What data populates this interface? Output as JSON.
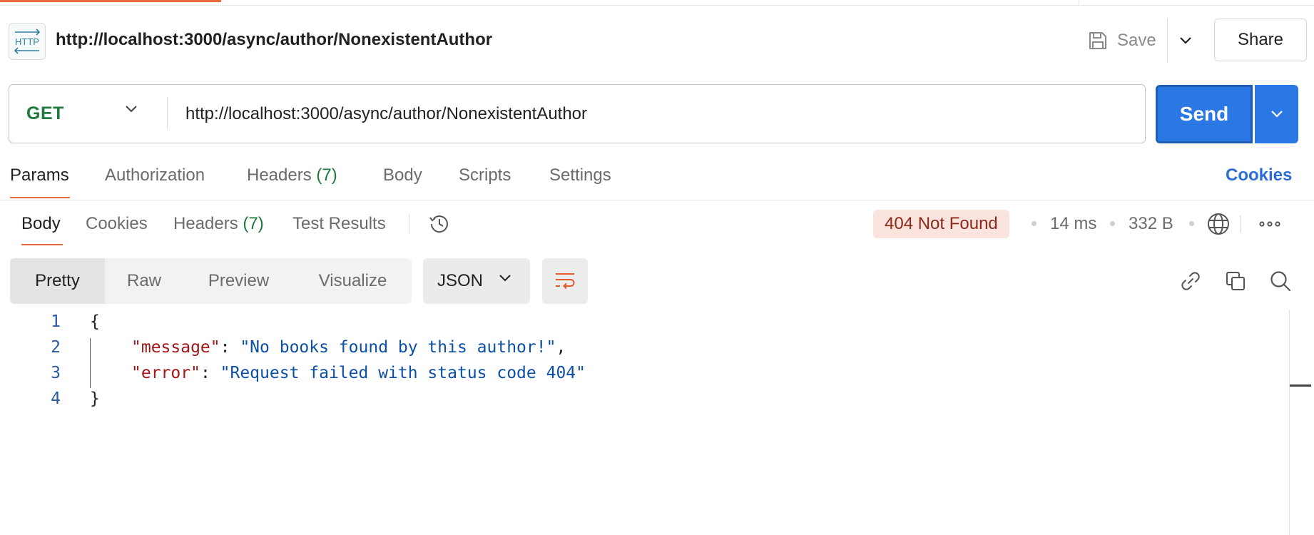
{
  "header": {
    "icon_text": "HTTP",
    "request_title": "http://localhost:3000/async/author/NonexistentAuthor",
    "save_label": "Save",
    "share_label": "Share"
  },
  "request": {
    "method": "GET",
    "url": "http://localhost:3000/async/author/NonexistentAuthor",
    "send_label": "Send"
  },
  "request_tabs": {
    "params": "Params",
    "authorization": "Authorization",
    "headers": "Headers",
    "headers_count": "(7)",
    "body": "Body",
    "scripts": "Scripts",
    "settings": "Settings",
    "cookies_link": "Cookies"
  },
  "response_tabs": {
    "body": "Body",
    "cookies": "Cookies",
    "headers": "Headers",
    "headers_count": "(7)",
    "test_results": "Test Results"
  },
  "response_meta": {
    "status": "404 Not Found",
    "time": "14 ms",
    "size": "332 B"
  },
  "view_options": {
    "pretty": "Pretty",
    "raw": "Raw",
    "preview": "Preview",
    "visualize": "Visualize",
    "format": "JSON"
  },
  "code": {
    "line_numbers": [
      "1",
      "2",
      "3",
      "4"
    ],
    "open_brace": "{",
    "close_brace": "}",
    "line2_key": "\"message\"",
    "line2_value": "\"No books found by this author!\"",
    "line3_key": "\"error\"",
    "line3_value": "\"Request failed with status code 404\""
  },
  "colors": {
    "accent_orange": "#ea6a3e",
    "send_blue": "#2b78e4",
    "method_green": "#1e7a3c",
    "status_bg": "#fbe4de",
    "status_text": "#8c2a1a"
  },
  "icons": [
    "http-icon",
    "save-icon",
    "chevron-down-icon",
    "history-icon",
    "globe-icon",
    "more-icon",
    "wrap-lines-icon",
    "link-icon",
    "copy-icon",
    "search-icon"
  ]
}
